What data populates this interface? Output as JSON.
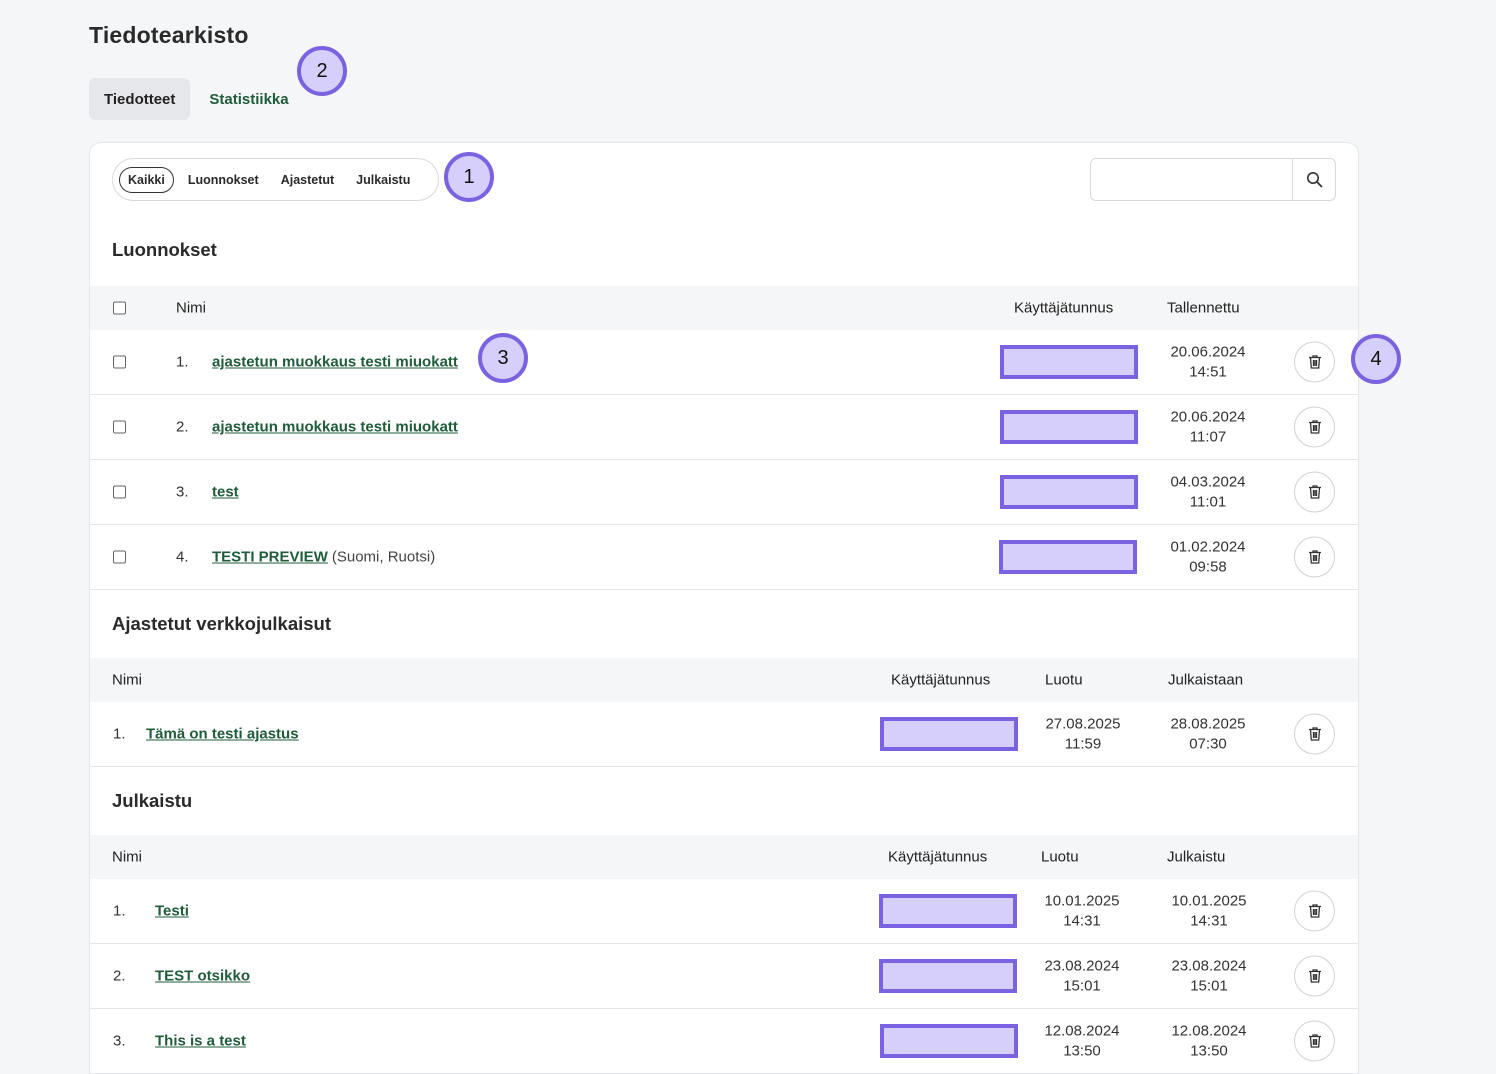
{
  "page": {
    "title": "Tiedotearkisto"
  },
  "tabs": [
    {
      "label": "Tiedotteet",
      "active": true
    },
    {
      "label": "Statistiikka",
      "active": false
    }
  ],
  "filters": [
    "Kaikki",
    "Luonnokset",
    "Ajastetut",
    "Julkaistu"
  ],
  "search": {
    "placeholder": "",
    "value": ""
  },
  "annotations": [
    "1",
    "2",
    "3",
    "4"
  ],
  "drafts": {
    "title": "Luonnokset",
    "headers": {
      "name": "Nimi",
      "user": "Käyttäjätunnus",
      "saved": "Tallennettu"
    },
    "rows": [
      {
        "num": "1.",
        "name": "ajastetun muokkaus testi miuokatt",
        "extra": "",
        "date": "20.06.2024",
        "time": "14:51"
      },
      {
        "num": "2.",
        "name": "ajastetun muokkaus testi miuokatt",
        "extra": "",
        "date": "20.06.2024",
        "time": "11:07"
      },
      {
        "num": "3.",
        "name": "test",
        "extra": "",
        "date": "04.03.2024",
        "time": "11:01"
      },
      {
        "num": "4.",
        "name": "TESTI PREVIEW",
        "extra": "(Suomi, Ruotsi)",
        "date": "01.02.2024",
        "time": "09:58"
      }
    ]
  },
  "scheduled": {
    "title": "Ajastetut verkkojulkaisut",
    "headers": {
      "name": "Nimi",
      "user": "Käyttäjätunnus",
      "created": "Luotu",
      "publish": "Julkaistaan"
    },
    "rows": [
      {
        "num": "1.",
        "name": "Tämä on testi ajastus",
        "created_date": "27.08.2025",
        "created_time": "11:59",
        "pub_date": "28.08.2025",
        "pub_time": "07:30"
      }
    ]
  },
  "published": {
    "title": "Julkaistu",
    "headers": {
      "name": "Nimi",
      "user": "Käyttäjätunnus",
      "created": "Luotu",
      "published": "Julkaistu"
    },
    "rows": [
      {
        "num": "1.",
        "name": "Testi",
        "created_date": "10.01.2025",
        "created_time": "14:31",
        "pub_date": "10.01.2025",
        "pub_time": "14:31"
      },
      {
        "num": "2.",
        "name": "TEST otsikko",
        "created_date": "23.08.2024",
        "created_time": "15:01",
        "pub_date": "23.08.2024",
        "pub_time": "15:01"
      },
      {
        "num": "3.",
        "name": "This is a test",
        "created_date": "12.08.2024",
        "created_time": "13:50",
        "pub_date": "12.08.2024",
        "pub_time": "13:50"
      }
    ]
  },
  "colors": {
    "accent": "#1f5c3a",
    "annotation_fill": "#d6cffb",
    "annotation_border": "#7b62e0"
  }
}
